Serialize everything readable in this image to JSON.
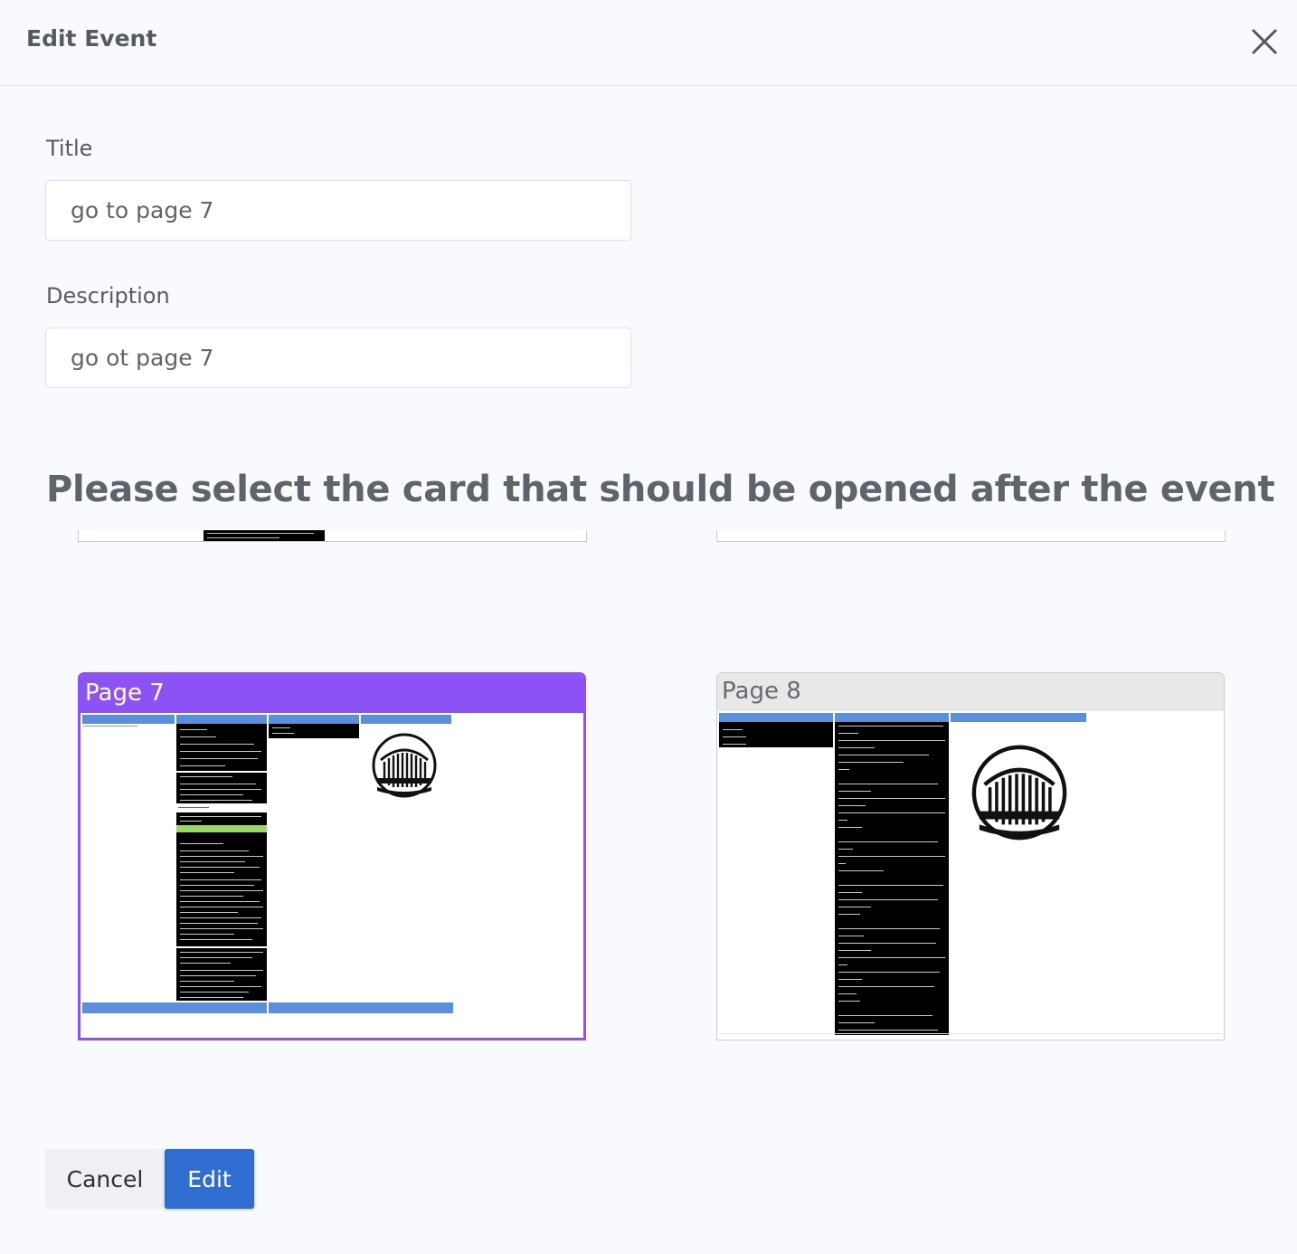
{
  "dialog": {
    "title": "Edit Event"
  },
  "form": {
    "title_label": "Title",
    "title_value": "go to page 7",
    "description_label": "Description",
    "description_value": "go ot page 7"
  },
  "prompt": "Please select the card that should be opened after the event",
  "cards": [
    {
      "name": "Page 7",
      "selected": true
    },
    {
      "name": "Page 8",
      "selected": false
    }
  ],
  "colors": {
    "selected_accent": "#8c52f5",
    "primary_button": "#2f6ed0",
    "thumbnail_header": "#5b8fdc"
  },
  "actions": {
    "cancel_label": "Cancel",
    "edit_label": "Edit"
  }
}
